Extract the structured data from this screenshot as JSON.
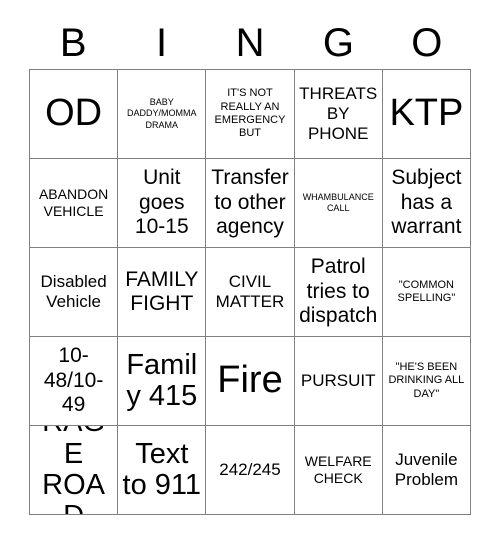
{
  "card": {
    "type": "bingo-card",
    "columns": 5,
    "rows": 5,
    "header_letters": [
      "B",
      "I",
      "N",
      "G",
      "O"
    ],
    "cells": [
      {
        "text": "OD",
        "size": "xxl"
      },
      {
        "text": "BABY DADDY/MOMMA DRAMA",
        "size": "xxs"
      },
      {
        "text": "IT'S NOT REALLY AN EMERGENCY BUT",
        "size": "xs"
      },
      {
        "text": "THREATS BY PHONE",
        "size": "md"
      },
      {
        "text": "KTP",
        "size": "xxl"
      },
      {
        "text": "ABANDON VEHICLE",
        "size": "sm"
      },
      {
        "text": "Unit goes 10-15",
        "size": "lg"
      },
      {
        "text": "Transfer to other agency",
        "size": "lg"
      },
      {
        "text": "WHAMBULANCE CALL",
        "size": "xxs"
      },
      {
        "text": "Subject has a warrant",
        "size": "lg"
      },
      {
        "text": "Disabled Vehicle",
        "size": "md"
      },
      {
        "text": "FAMILY FIGHT",
        "size": "lg"
      },
      {
        "text": "CIVIL MATTER",
        "size": "md"
      },
      {
        "text": "Patrol tries to dispatch",
        "size": "lg"
      },
      {
        "text": "\"COMMON SPELLING\"",
        "size": "xs"
      },
      {
        "text": "10-48/10-49",
        "size": "lg"
      },
      {
        "text": "Family 415",
        "size": "xl"
      },
      {
        "text": "Fire",
        "size": "xxl"
      },
      {
        "text": "PURSUIT",
        "size": "md"
      },
      {
        "text": "\"HE'S BEEN DRINKING ALL DAY\"",
        "size": "xs"
      },
      {
        "text": "RAGE ROAD",
        "size": "xl"
      },
      {
        "text": "Text to 911",
        "size": "xl"
      },
      {
        "text": "242/245",
        "size": "md"
      },
      {
        "text": "WELFARE CHECK",
        "size": "sm"
      },
      {
        "text": "Juvenile Problem",
        "size": "md"
      }
    ]
  }
}
